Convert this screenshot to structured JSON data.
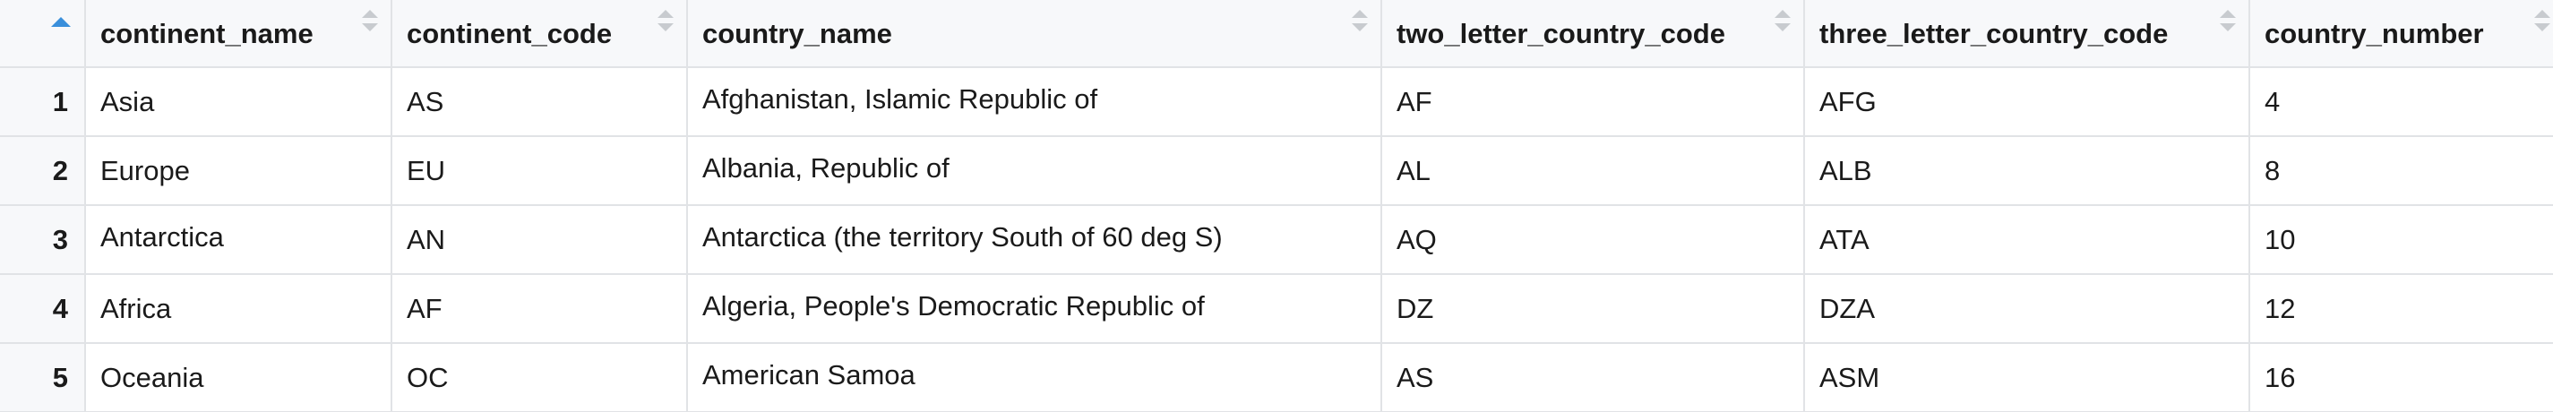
{
  "table": {
    "sorted_column": "index",
    "columns": [
      "continent_name",
      "continent_code",
      "country_name",
      "two_letter_country_code",
      "three_letter_country_code",
      "country_number"
    ],
    "rows": [
      {
        "index": "1",
        "cells": [
          "Asia",
          "AS",
          "Afghanistan, Islamic Republic of",
          "AF",
          "AFG",
          "4"
        ]
      },
      {
        "index": "2",
        "cells": [
          "Europe",
          "EU",
          "Albania, Republic of",
          "AL",
          "ALB",
          "8"
        ]
      },
      {
        "index": "3",
        "cells": [
          "Antarctica",
          "AN",
          "Antarctica (the territory South of 60 deg S)",
          "AQ",
          "ATA",
          "10"
        ]
      },
      {
        "index": "4",
        "cells": [
          "Africa",
          "AF",
          "Algeria, People's Democratic Republic of",
          "DZ",
          "DZA",
          "12"
        ]
      },
      {
        "index": "5",
        "cells": [
          "Oceania",
          "OC",
          "American Samoa",
          "AS",
          "ASM",
          "16"
        ]
      }
    ]
  },
  "colors": {
    "accent": "#3a8fdb",
    "header_bg": "#f7f8fa",
    "grid_line": "#e1e3e6"
  }
}
